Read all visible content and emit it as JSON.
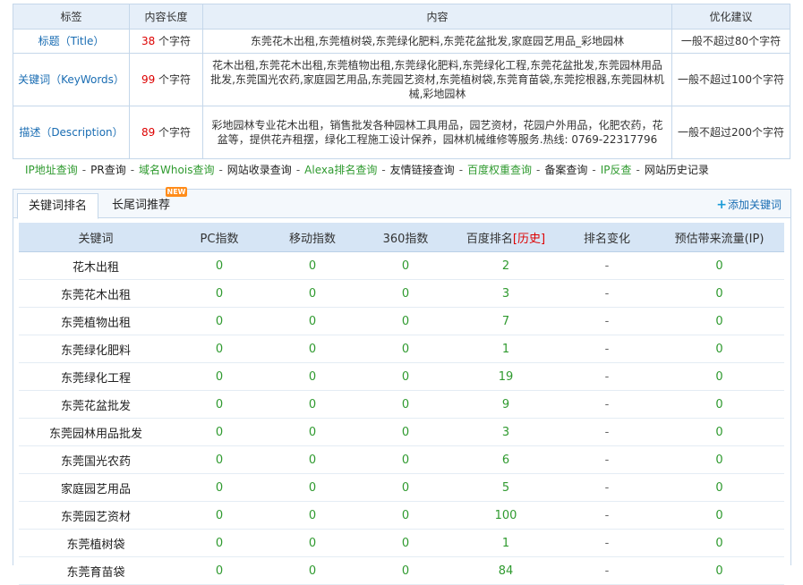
{
  "meta_table": {
    "headers": [
      "标签",
      "内容长度",
      "内容",
      "优化建议"
    ],
    "rows": [
      {
        "label": "标题（Title）",
        "length": "38",
        "unit": "个字符",
        "content": "东莞花木出租,东莞植树袋,东莞绿化肥料,东莞花盆批发,家庭园艺用品_彩地园林",
        "suggestion": "一般不超过80个字符"
      },
      {
        "label": "关键词（KeyWords）",
        "length": "99",
        "unit": "个字符",
        "content": "花木出租,东莞花木出租,东莞植物出租,东莞绿化肥料,东莞绿化工程,东莞花盆批发,东莞园林用品批发,东莞国光农药,家庭园艺用品,东莞园艺资材,东莞植树袋,东莞育苗袋,东莞挖根器,东莞园林机械,彩地园林",
        "suggestion": "一般不超过100个字符"
      },
      {
        "label": "描述（Description）",
        "length": "89",
        "unit": "个字符",
        "content": "彩地园林专业花木出租，销售批发各种园林工具用品，园艺资材，花园户外用品，化肥农药，花盆等，提供花卉租摆，绿化工程施工设计保养，园林机械维修等服务.热线: 0769-22317796",
        "suggestion": "一般不超过200个字符"
      }
    ]
  },
  "tool_links": [
    {
      "text": "IP地址查询",
      "color": "green"
    },
    {
      "text": "PR查询",
      "color": "dark"
    },
    {
      "text": "域名Whois查询",
      "color": "green"
    },
    {
      "text": "网站收录查询",
      "color": "dark"
    },
    {
      "text": "Alexa排名查询",
      "color": "green"
    },
    {
      "text": "友情链接查询",
      "color": "dark"
    },
    {
      "text": "百度权重查询",
      "color": "green"
    },
    {
      "text": "备案查询",
      "color": "dark"
    },
    {
      "text": "IP反查",
      "color": "green"
    },
    {
      "text": "网站历史记录",
      "color": "dark"
    }
  ],
  "tabs": {
    "active": "关键词排名",
    "second": "长尾词推荐",
    "badge": "NEW",
    "add_keyword": "添加关键词"
  },
  "keyword_table": {
    "headers": [
      "关键词",
      "PC指数",
      "移动指数",
      "360指数",
      "百度排名",
      "排名变化",
      "预估带来流量(IP)"
    ],
    "history_label": "[历史]",
    "rows": [
      {
        "keyword": "花木出租",
        "pc": "0",
        "mobile": "0",
        "s360": "0",
        "rank": "2",
        "change": "-",
        "traffic": "0"
      },
      {
        "keyword": "东莞花木出租",
        "pc": "0",
        "mobile": "0",
        "s360": "0",
        "rank": "3",
        "change": "-",
        "traffic": "0"
      },
      {
        "keyword": "东莞植物出租",
        "pc": "0",
        "mobile": "0",
        "s360": "0",
        "rank": "7",
        "change": "-",
        "traffic": "0"
      },
      {
        "keyword": "东莞绿化肥料",
        "pc": "0",
        "mobile": "0",
        "s360": "0",
        "rank": "1",
        "change": "-",
        "traffic": "0"
      },
      {
        "keyword": "东莞绿化工程",
        "pc": "0",
        "mobile": "0",
        "s360": "0",
        "rank": "19",
        "change": "-",
        "traffic": "0"
      },
      {
        "keyword": "东莞花盆批发",
        "pc": "0",
        "mobile": "0",
        "s360": "0",
        "rank": "9",
        "change": "-",
        "traffic": "0"
      },
      {
        "keyword": "东莞园林用品批发",
        "pc": "0",
        "mobile": "0",
        "s360": "0",
        "rank": "3",
        "change": "-",
        "traffic": "0"
      },
      {
        "keyword": "东莞国光农药",
        "pc": "0",
        "mobile": "0",
        "s360": "0",
        "rank": "6",
        "change": "-",
        "traffic": "0"
      },
      {
        "keyword": "家庭园艺用品",
        "pc": "0",
        "mobile": "0",
        "s360": "0",
        "rank": "5",
        "change": "-",
        "traffic": "0"
      },
      {
        "keyword": "东莞园艺资材",
        "pc": "0",
        "mobile": "0",
        "s360": "0",
        "rank": "100",
        "change": "-",
        "traffic": "0"
      },
      {
        "keyword": "东莞植树袋",
        "pc": "0",
        "mobile": "0",
        "s360": "0",
        "rank": "1",
        "change": "-",
        "traffic": "0"
      },
      {
        "keyword": "东莞育苗袋",
        "pc": "0",
        "mobile": "0",
        "s360": "0",
        "rank": "84",
        "change": "-",
        "traffic": "0"
      }
    ]
  },
  "colors": {
    "accent_green": "#2f9a2f",
    "link_blue": "#1a6db3",
    "alert_red": "#dd0000",
    "header_bg": "#d6e5f5"
  }
}
